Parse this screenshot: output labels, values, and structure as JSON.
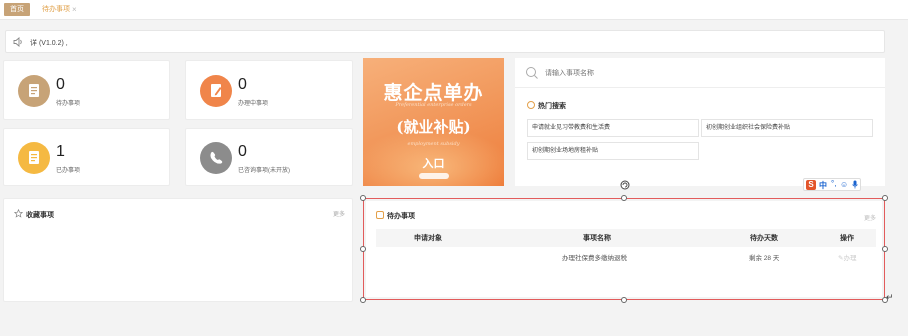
{
  "tabs": {
    "home_label": "首页",
    "pending_label": "待办事项",
    "close_glyph": "×"
  },
  "notice": {
    "text": "详 (V1.0.2) ,"
  },
  "stats": [
    {
      "value": "0",
      "label": "待办事项",
      "color": "#c7a377"
    },
    {
      "value": "0",
      "label": "办理中事项",
      "color": "#f0854a"
    },
    {
      "value": "1",
      "label": "已办事项",
      "color": "#f5b942"
    },
    {
      "value": "0",
      "label": "已咨询事项(未开放)",
      "color": "#8c8c8c"
    }
  ],
  "banner": {
    "title": "惠企点单办",
    "eng": "Preferential enterprise orders",
    "subtitle": "(就业补贴)",
    "eng2": "employment subsidy",
    "entry": "入口"
  },
  "search": {
    "placeholder": "请输入事项名称"
  },
  "hot": {
    "title": "热门搜索",
    "items": [
      "申请就业见习带教费和生活费",
      "初创期创业组织社会保险费补贴",
      "初创期创业场地房租补贴"
    ]
  },
  "favorites": {
    "title": "收藏事项",
    "more": "更多"
  },
  "pending": {
    "title": "待办事项",
    "more": "更多",
    "columns": [
      "申请对象",
      "事项名称",
      "待办天数",
      "操作"
    ],
    "rows": [
      {
        "applicant": "",
        "item": "办理社保费多缴纳退税",
        "days": "剩余 28 天",
        "action": "办理"
      }
    ]
  },
  "ime": {
    "s": "S",
    "zh": "中",
    "punct": "°,",
    "emoji": "☺",
    "mic": "🎙"
  },
  "colors": {
    "accent": "#c7a377",
    "orange": "#f0854a",
    "selection": "#e25b5b"
  }
}
